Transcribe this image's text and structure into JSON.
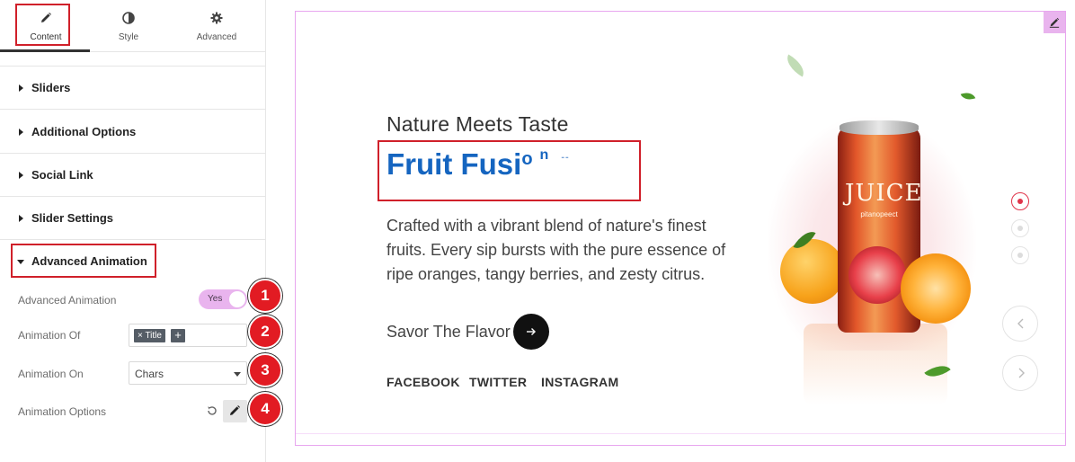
{
  "tabs": [
    {
      "label": "Content",
      "icon": "pencil-icon",
      "active": true
    },
    {
      "label": "Style",
      "icon": "half-circle-icon",
      "active": false
    },
    {
      "label": "Advanced",
      "icon": "gear-icon",
      "active": false
    }
  ],
  "sections": [
    {
      "label": "Sliders"
    },
    {
      "label": "Additional Options"
    },
    {
      "label": "Social Link"
    },
    {
      "label": "Slider Settings"
    },
    {
      "label": "Advanced Animation",
      "expanded": true
    }
  ],
  "advanced_animation": {
    "toggle_label": "Advanced Animation",
    "toggle_value": "Yes",
    "animation_of_label": "Animation Of",
    "animation_of_tag": "Title",
    "animation_of_add": "+",
    "animation_on_label": "Animation On",
    "animation_on_value": "Chars",
    "animation_options_label": "Animation Options"
  },
  "badges": [
    "1",
    "2",
    "3",
    "4"
  ],
  "preview": {
    "subtitle": "Nature Meets Taste",
    "title_main": "Fruit Fusi",
    "title_char_o": "o",
    "title_char_n": "n",
    "title_dots": "--",
    "description": "Crafted with a vibrant blend of nature's finest fruits. Every sip bursts with the pure essence of ripe oranges, tangy berries, and zesty citrus.",
    "cta_label": "Savor The Flavor",
    "social": [
      "FACEBOOK",
      "TWITTER",
      "INSTAGRAM"
    ],
    "can_label": "JUICE",
    "can_sub": "pitanopeect",
    "slide_count": 3,
    "active_slide": 1
  },
  "colors": {
    "accent_pink": "#e9b4ee",
    "title_blue": "#1565c0",
    "highlight_red": "#d0202a",
    "badge_red": "#e21b23",
    "active_dot": "#e0344a"
  }
}
